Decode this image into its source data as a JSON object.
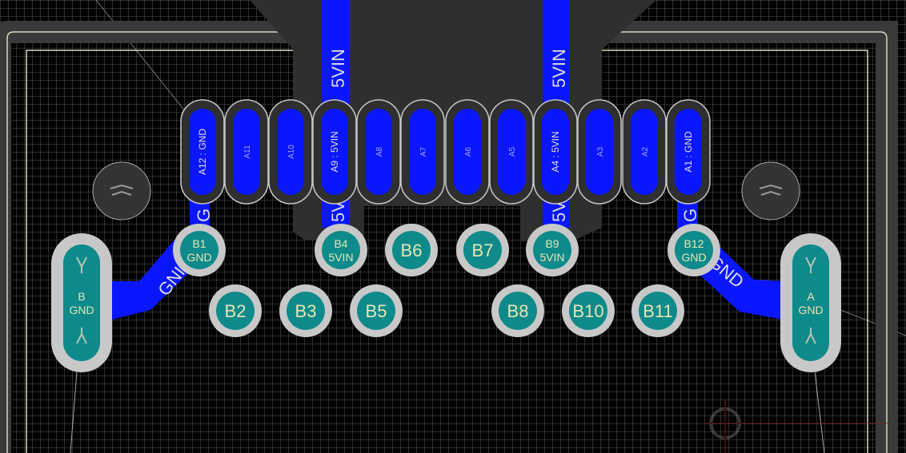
{
  "pcb": {
    "top_pads": [
      {
        "id": "A12",
        "label": "A12 : GND",
        "net": "GND",
        "filled": true
      },
      {
        "id": "A11",
        "label": "A11",
        "net": "",
        "filled": true
      },
      {
        "id": "A10",
        "label": "A10",
        "net": "",
        "filled": true
      },
      {
        "id": "A9",
        "label": "A9 : 5VIN",
        "net": "5VIN",
        "filled": false
      },
      {
        "id": "A8",
        "label": "A8",
        "net": "",
        "filled": true
      },
      {
        "id": "A7",
        "label": "A7",
        "net": "",
        "filled": true
      },
      {
        "id": "A6",
        "label": "A6",
        "net": "",
        "filled": true
      },
      {
        "id": "A5",
        "label": "A5",
        "net": "",
        "filled": true
      },
      {
        "id": "A4",
        "label": "A4 : 5VIN",
        "net": "5VIN",
        "filled": false
      },
      {
        "id": "A3",
        "label": "A3",
        "net": "",
        "filled": true
      },
      {
        "id": "A2",
        "label": "A2",
        "net": "",
        "filled": true
      },
      {
        "id": "A1",
        "label": "A1 : GND",
        "net": "GND",
        "filled": true
      }
    ],
    "via_pads_row1": [
      {
        "id": "B1",
        "line1": "B1",
        "line2": "GND"
      },
      {
        "id": "B4",
        "line1": "B4",
        "line2": "5VIN"
      },
      {
        "id": "B6",
        "line1": "B6",
        "line2": ""
      },
      {
        "id": "B7",
        "line1": "B7",
        "line2": ""
      },
      {
        "id": "B9",
        "line1": "B9",
        "line2": "5VIN"
      },
      {
        "id": "B12",
        "line1": "B12",
        "line2": "GND"
      }
    ],
    "via_pads_row2": [
      {
        "id": "B2",
        "line1": "B2"
      },
      {
        "id": "B3",
        "line1": "B3"
      },
      {
        "id": "B5",
        "line1": "B5"
      },
      {
        "id": "B8",
        "line1": "B8"
      },
      {
        "id": "B10",
        "line1": "B10"
      },
      {
        "id": "B11",
        "line1": "B11"
      }
    ],
    "mount_pads": [
      {
        "id": "B",
        "line1": "B",
        "line2": "GND"
      },
      {
        "id": "A",
        "line1": "A",
        "line2": "GND"
      }
    ],
    "trace_labels": {
      "vin_top_left": "5VIN",
      "vin_top_right": "5VIN",
      "vin_bottom_left": "5V",
      "vin_bottom_right": "5V",
      "gnd_left_short": "G",
      "gnd_right_short": "G",
      "gnd_left_long": "GNI",
      "gnd_right_long": "GND"
    },
    "colors": {
      "background": "#000000",
      "grid": "#5a5a5a",
      "outline": "#d8d8c0",
      "copper": "#0a16ff",
      "courtyard": "#2f2f2f",
      "pad_ring": "#c8c8c8",
      "pad_fill": "#0e8a8a",
      "text": "#e6e6b4"
    }
  }
}
